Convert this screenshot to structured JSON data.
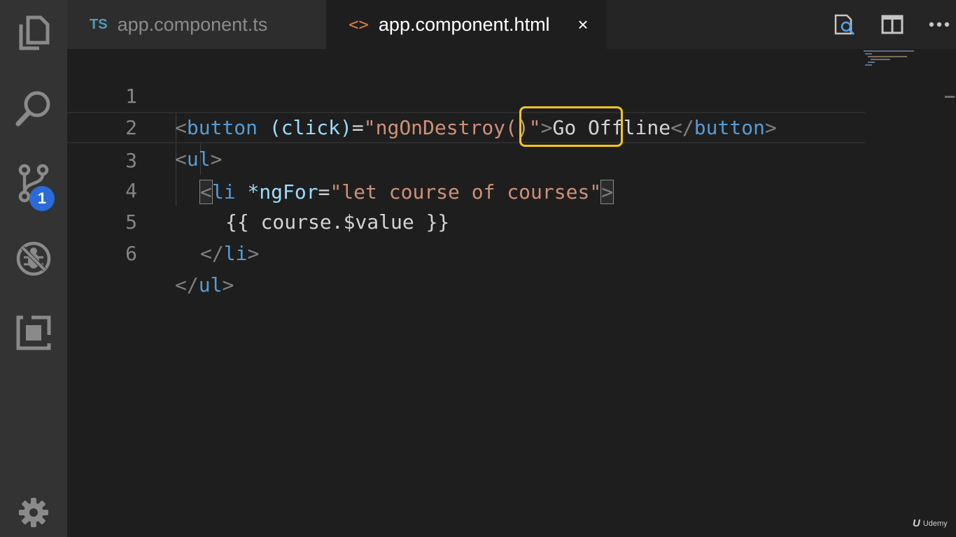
{
  "tabs": [
    {
      "icon_label": "TS",
      "label": "app.component.ts",
      "active": false
    },
    {
      "icon_label": "<>",
      "label": "app.component.html",
      "active": true,
      "close": "×"
    }
  ],
  "activity_bar": {
    "icons": [
      "explorer-icon",
      "search-icon",
      "source-control-icon",
      "debug-icon",
      "extensions-icon",
      "settings-gear-icon"
    ],
    "source_control_badge": "1"
  },
  "editor": {
    "line_numbers": [
      "1",
      "2",
      "3",
      "4",
      "5",
      "6"
    ],
    "lines": [
      [
        "<",
        "button",
        " ",
        "(click)",
        "=",
        "\"ngOnDestroy()\"",
        ">",
        "Go Offline",
        "</",
        "button",
        ">"
      ],
      [
        "<",
        "ul",
        ">"
      ],
      [
        "<",
        "li",
        " ",
        "*ngFor",
        "=",
        "\"let course of courses\"",
        ">"
      ],
      [
        "{{ course.$value }}"
      ],
      [
        "</",
        "li",
        ">"
      ],
      [
        "</",
        "ul",
        ">"
      ]
    ],
    "highlighted_text": "courses",
    "current_line": 3
  },
  "watermark": {
    "logo": "U",
    "text": "Udemy"
  },
  "colors": {
    "activity_bar": "#333333",
    "editor_bg": "#1e1e1e",
    "tag": "#569cd6",
    "attribute": "#9cdcfe",
    "string": "#ce9178",
    "highlight_box": "#f5c518",
    "badge": "#2b6bd8"
  }
}
